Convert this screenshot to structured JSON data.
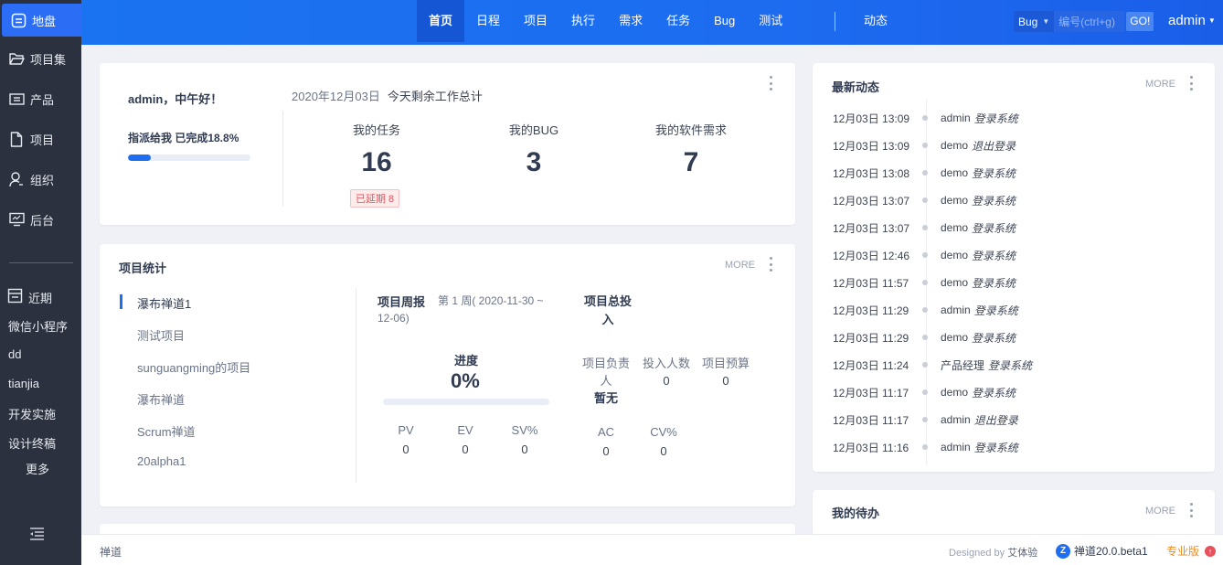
{
  "sidebar": {
    "items": [
      {
        "label": "地盘",
        "icon": "home-icon"
      },
      {
        "label": "项目集",
        "icon": "folder-open-icon"
      },
      {
        "label": "产品",
        "icon": "product-icon"
      },
      {
        "label": "项目",
        "icon": "file-icon"
      },
      {
        "label": "组织",
        "icon": "user-icon"
      },
      {
        "label": "后台",
        "icon": "monitor-icon"
      }
    ],
    "recent_label": "近期",
    "recent": [
      "微信小程序",
      "dd",
      "tianjia",
      "开发实施",
      "设计终稿"
    ],
    "more_label": "更多"
  },
  "topnav": {
    "items": [
      "首页",
      "日程",
      "项目",
      "执行",
      "需求",
      "任务",
      "Bug",
      "测试"
    ],
    "dynamic": "动态",
    "search_type": "Bug",
    "search_placeholder": "编号(ctrl+g)",
    "search_go": "GO!",
    "user": "admin"
  },
  "welcome": {
    "greeting": "admin，中午好！",
    "assigned_text": "指派给我 已完成18.8%",
    "assigned_progress": 0.188,
    "date": "2020年12月03日",
    "subtitle": "今天剩余工作总计",
    "stats": [
      {
        "label": "我的任务",
        "value": "16"
      },
      {
        "label": "我的BUG",
        "value": "3"
      },
      {
        "label": "我的软件需求",
        "value": "7"
      }
    ],
    "delay_badge": "已延期 8"
  },
  "project_stats": {
    "title": "项目统计",
    "more": "MORE",
    "projects": [
      "瀑布禅道1",
      "测试项目",
      "sunguangming的项目",
      "瀑布禅道",
      "Scrum禅道",
      "20alpha1"
    ],
    "weekly_title": "项目周报",
    "weekly_range": "第 1 周( 2020-11-30 ~ 12-06)",
    "progress_label": "进度",
    "progress_value": "0%",
    "metrics": [
      {
        "label": "PV",
        "value": "0"
      },
      {
        "label": "EV",
        "value": "0"
      },
      {
        "label": "SV%",
        "value": "0"
      }
    ],
    "invest_title": "项目总投入",
    "invest": [
      {
        "label": "项目负责人",
        "value": "暂无"
      },
      {
        "label": "投入人数",
        "value": "0"
      },
      {
        "label": "项目预算",
        "value": "0"
      }
    ],
    "metrics2": [
      {
        "label": "AC",
        "value": "0"
      },
      {
        "label": "CV%",
        "value": "0"
      }
    ]
  },
  "activity": {
    "title": "最新动态",
    "more": "MORE",
    "rows": [
      {
        "time": "12月03日 13:09",
        "user": "admin",
        "action": "登录系统"
      },
      {
        "time": "12月03日 13:09",
        "user": "demo",
        "action": "退出登录"
      },
      {
        "time": "12月03日 13:08",
        "user": "demo",
        "action": "登录系统"
      },
      {
        "time": "12月03日 13:07",
        "user": "demo",
        "action": "登录系统"
      },
      {
        "time": "12月03日 13:07",
        "user": "demo",
        "action": "登录系统"
      },
      {
        "time": "12月03日 12:46",
        "user": "demo",
        "action": "登录系统"
      },
      {
        "time": "12月03日 11:57",
        "user": "demo",
        "action": "登录系统"
      },
      {
        "time": "12月03日 11:29",
        "user": "admin",
        "action": "登录系统"
      },
      {
        "time": "12月03日 11:29",
        "user": "demo",
        "action": "登录系统"
      },
      {
        "time": "12月03日 11:24",
        "user": "产品经理",
        "action": "登录系统"
      },
      {
        "time": "12月03日 11:17",
        "user": "demo",
        "action": "登录系统"
      },
      {
        "time": "12月03日 11:17",
        "user": "admin",
        "action": "退出登录"
      },
      {
        "time": "12月03日 11:16",
        "user": "admin",
        "action": "登录系统"
      }
    ]
  },
  "todo": {
    "title": "我的待办",
    "more": "MORE"
  },
  "footer": {
    "left": "禅道",
    "designed_by": "Designed by",
    "brand": "艾体验",
    "version": "禅道20.0.beta1",
    "edition": "专业版"
  },
  "colors": {
    "primary": "#1f6df1",
    "sidebar_bg": "#2b313e",
    "danger": "#e8505b",
    "edition": "#e98b1e"
  }
}
